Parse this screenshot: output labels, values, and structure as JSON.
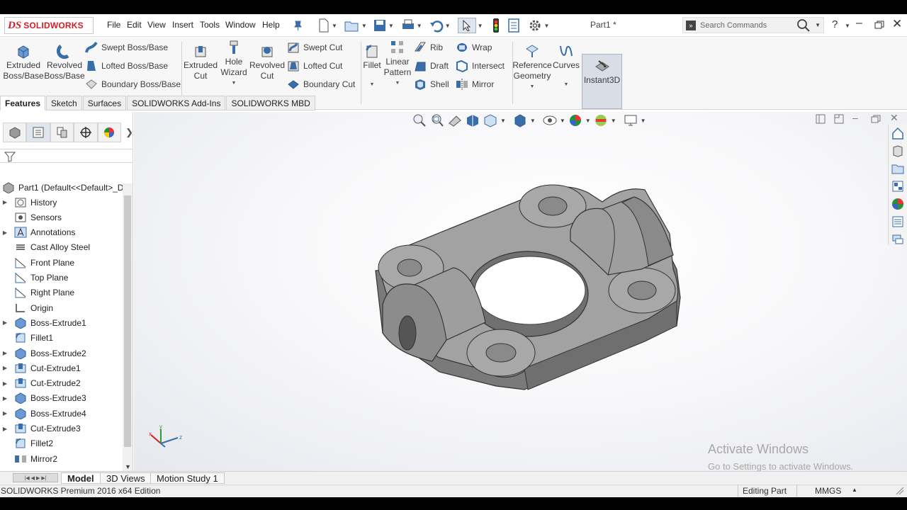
{
  "app": {
    "product": "SOLIDWORKS",
    "doc_title": "Part1 *"
  },
  "menu": [
    "File",
    "Edit",
    "View",
    "Insert",
    "Tools",
    "Window",
    "Help"
  ],
  "search": {
    "placeholder": "Search Commands",
    "help": "?"
  },
  "ribbon": {
    "extruded_boss": [
      "Extruded",
      "Boss/Base"
    ],
    "revolved_boss": [
      "Revolved",
      "Boss/Base"
    ],
    "swept_boss": "Swept Boss/Base",
    "lofted_boss": "Lofted Boss/Base",
    "boundary_boss": "Boundary Boss/Base",
    "extruded_cut": [
      "Extruded",
      "Cut"
    ],
    "hole_wizard": [
      "Hole",
      "Wizard"
    ],
    "revolved_cut": [
      "Revolved",
      "Cut"
    ],
    "swept_cut": "Swept Cut",
    "lofted_cut": "Lofted Cut",
    "boundary_cut": "Boundary Cut",
    "fillet": "Fillet",
    "linear_pattern": [
      "Linear",
      "Pattern"
    ],
    "rib": "Rib",
    "draft": "Draft",
    "shell": "Shell",
    "wrap": "Wrap",
    "intersect": "Intersect",
    "mirror": "Mirror",
    "reference_geometry": [
      "Reference",
      "Geometry"
    ],
    "curves": "Curves",
    "instant3d": "Instant3D"
  },
  "tabs": [
    "Features",
    "Sketch",
    "Surfaces",
    "SOLIDWORKS Add-Ins",
    "SOLIDWORKS MBD"
  ],
  "tree": {
    "root": "Part1  (Default<<Default>_D",
    "items": [
      {
        "label": "History",
        "expandable": true
      },
      {
        "label": "Sensors",
        "expandable": false
      },
      {
        "label": "Annotations",
        "expandable": true
      },
      {
        "label": "Cast Alloy Steel",
        "expandable": false
      },
      {
        "label": "Front Plane",
        "expandable": false
      },
      {
        "label": "Top Plane",
        "expandable": false
      },
      {
        "label": "Right Plane",
        "expandable": false
      },
      {
        "label": "Origin",
        "expandable": false
      },
      {
        "label": "Boss-Extrude1",
        "expandable": true
      },
      {
        "label": "Fillet1",
        "expandable": false
      },
      {
        "label": "Boss-Extrude2",
        "expandable": true
      },
      {
        "label": "Cut-Extrude1",
        "expandable": true
      },
      {
        "label": "Cut-Extrude2",
        "expandable": true
      },
      {
        "label": "Boss-Extrude3",
        "expandable": true
      },
      {
        "label": "Boss-Extrude4",
        "expandable": true
      },
      {
        "label": "Cut-Extrude3",
        "expandable": true
      },
      {
        "label": "Fillet2",
        "expandable": false
      },
      {
        "label": "Mirror2",
        "expandable": false
      }
    ]
  },
  "bottom_tabs": [
    "Model",
    "3D Views",
    "Motion Study 1"
  ],
  "status": {
    "edition": "SOLIDWORKS Premium 2016 x64 Edition",
    "mode": "Editing Part",
    "units": "MMGS"
  },
  "watermark": {
    "line1": "Activate Windows",
    "line2": "Go to Settings to activate Windows."
  },
  "triad": {
    "x": "x",
    "y": "y",
    "z": "z"
  },
  "colors": {
    "part_gray": "#8a8a8a",
    "part_top": "#a9a9a9",
    "brand_red": "#d21f26",
    "selected_bg": "#d8dde6",
    "icon_blue": "#3a6ea8"
  }
}
